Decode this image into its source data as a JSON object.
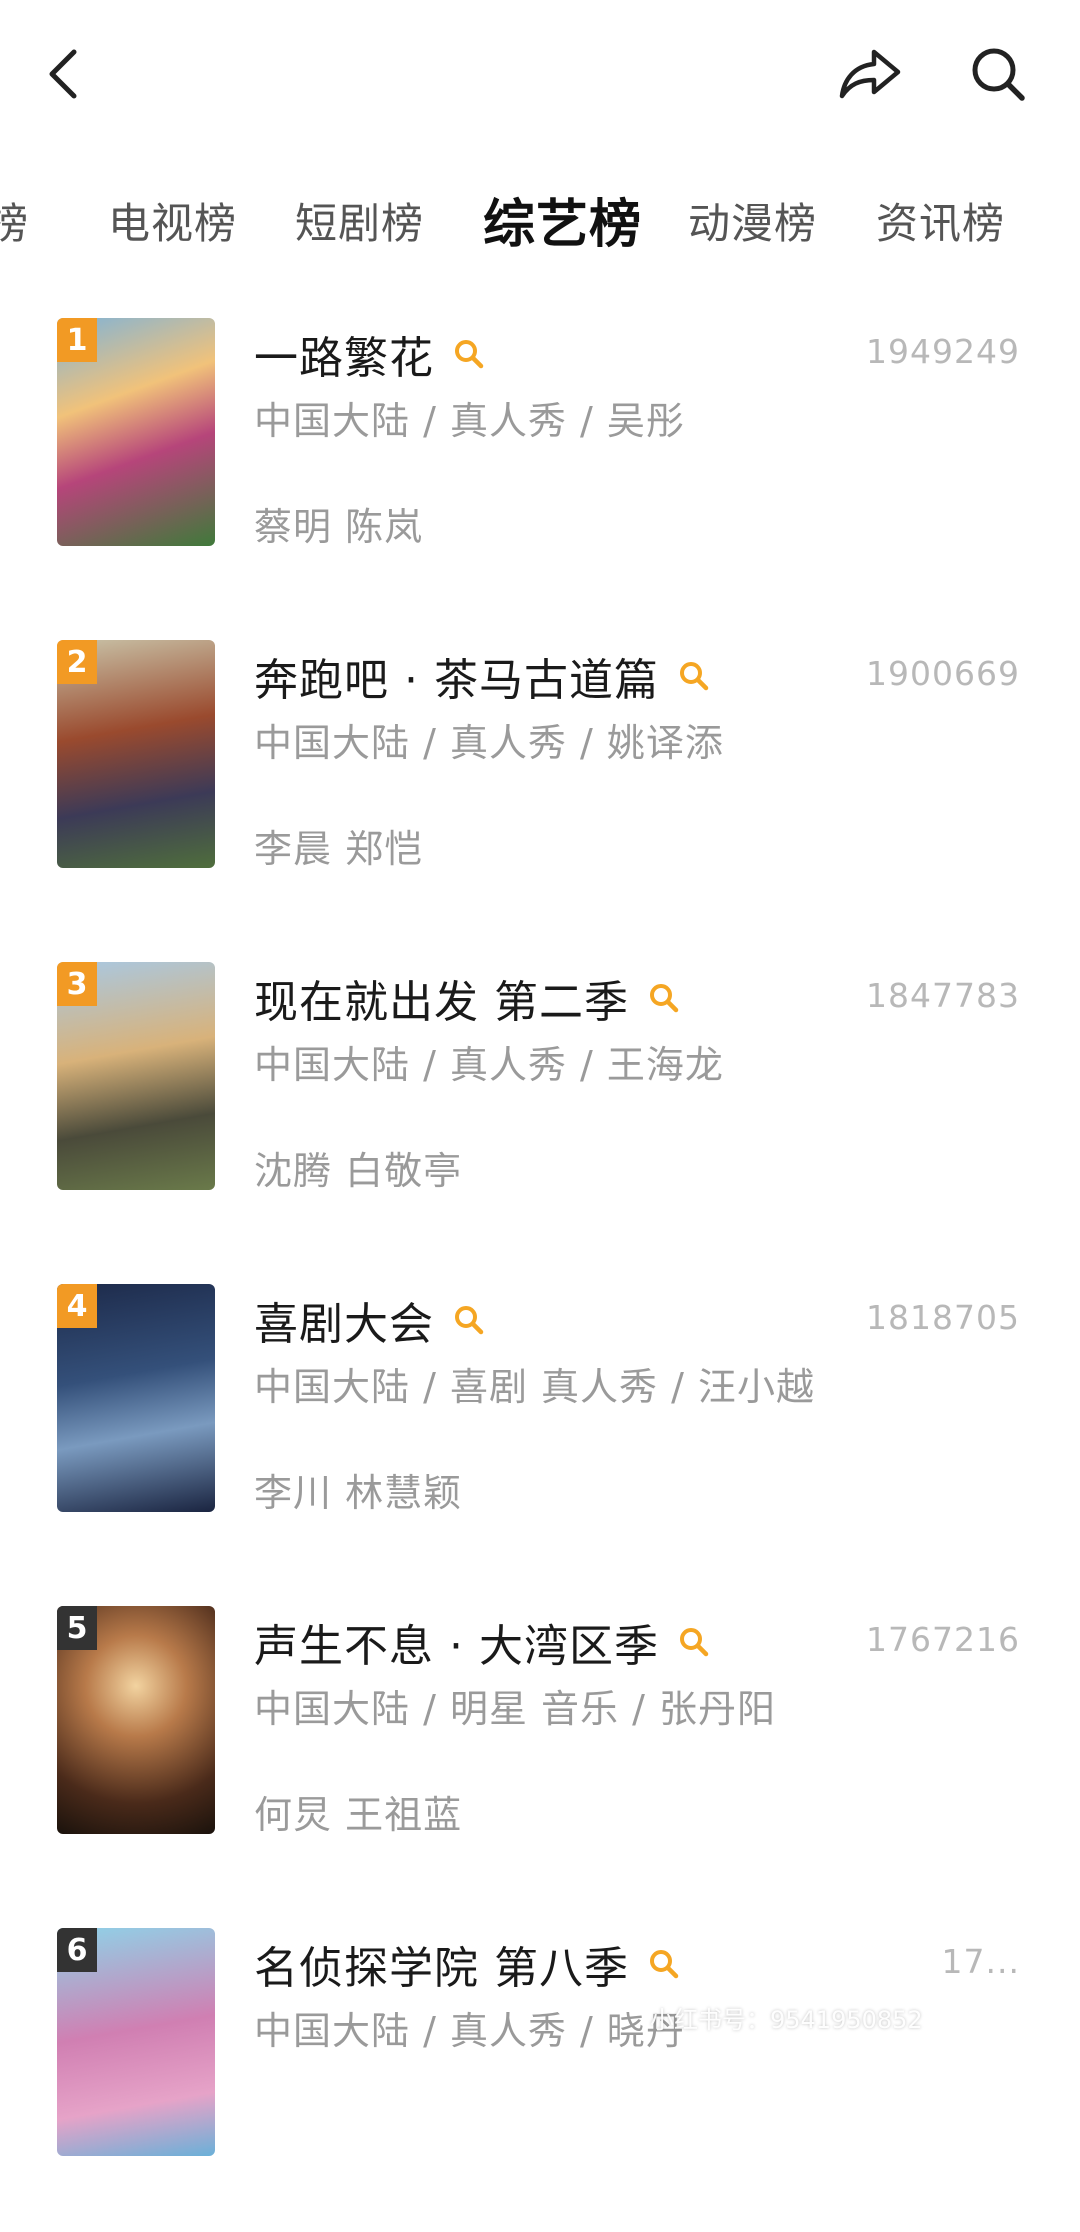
{
  "tabs": [
    {
      "label": "榜"
    },
    {
      "label": "电视榜"
    },
    {
      "label": "短剧榜"
    },
    {
      "label": "综艺榜"
    },
    {
      "label": "动漫榜"
    },
    {
      "label": "资讯榜"
    }
  ],
  "active_tab_index": 3,
  "colors": {
    "accent": "#f5a623",
    "rank_bg": "#f29a24",
    "rank_bg_dark": "#333333"
  },
  "items": [
    {
      "rank": "1",
      "title": "一路繁花",
      "score": "1949249",
      "meta": "中国大陆 / 真人秀 / 吴彤",
      "cast": "蔡明 陈岚"
    },
    {
      "rank": "2",
      "title": "奔跑吧 · 茶马古道篇",
      "score": "1900669",
      "meta": "中国大陆 / 真人秀 / 姚译添",
      "cast": "李晨 郑恺"
    },
    {
      "rank": "3",
      "title": "现在就出发 第二季",
      "score": "1847783",
      "meta": "中国大陆 / 真人秀 / 王海龙",
      "cast": "沈腾 白敬亭"
    },
    {
      "rank": "4",
      "title": "喜剧大会",
      "score": "1818705",
      "meta": "中国大陆 / 喜剧 真人秀 / 汪小越",
      "cast": "李川 林慧颖"
    },
    {
      "rank": "5",
      "title": "声生不息 · 大湾区季",
      "score": "1767216",
      "meta": "中国大陆 / 明星 音乐 / 张丹阳",
      "cast": "何炅 王祖蓝"
    },
    {
      "rank": "6",
      "title": "名侦探学院 第八季",
      "score": "17...",
      "meta": "中国大陆 / 真人秀 / 晓丹",
      "cast": ""
    }
  ],
  "watermark": "小红书号：9541950852"
}
